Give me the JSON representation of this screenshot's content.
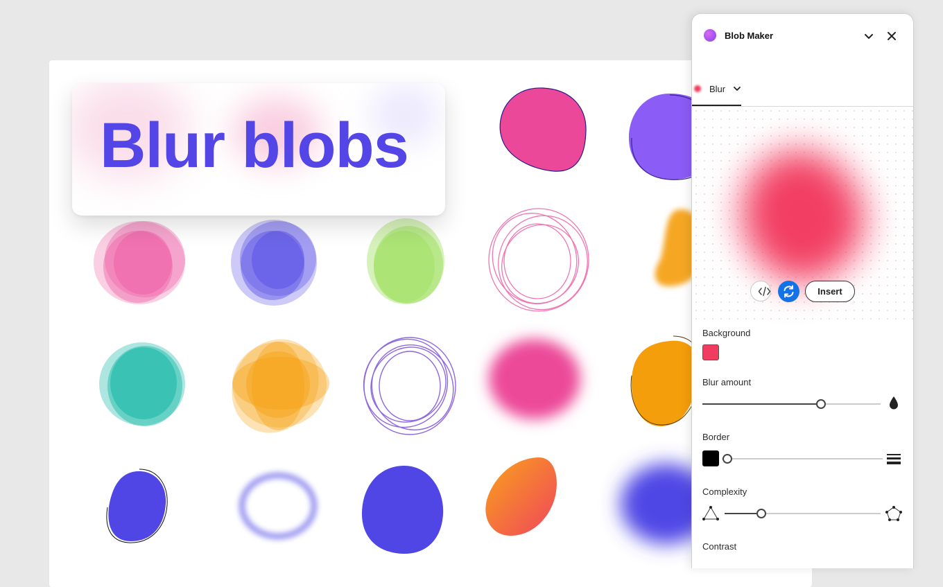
{
  "canvas": {
    "title": "Blur blobs"
  },
  "panel": {
    "plugin_name": "Blob Maker",
    "tab_label": "Blur",
    "preview_color": "#f23e62",
    "actions": {
      "code_icon": "code-icon",
      "refresh_icon": "refresh-icon",
      "insert_label": "Insert"
    },
    "background": {
      "label": "Background",
      "color": "#f03c5e"
    },
    "blur_amount": {
      "label": "Blur amount",
      "value_fraction": 0.67
    },
    "border": {
      "label": "Border",
      "color": "#000000",
      "value_fraction": 0.0
    },
    "complexity": {
      "label": "Complexity",
      "value_fraction": 0.24
    },
    "contrast": {
      "label": "Contrast"
    }
  },
  "colors": {
    "title": "#5445e6",
    "pink": "#ec4899",
    "indigo": "#4f46e5",
    "lime": "#a3e065",
    "teal": "#14b8a6",
    "orange": "#f59e0b",
    "violet": "#8b5cf6",
    "accent_blue": "#1472e6"
  }
}
